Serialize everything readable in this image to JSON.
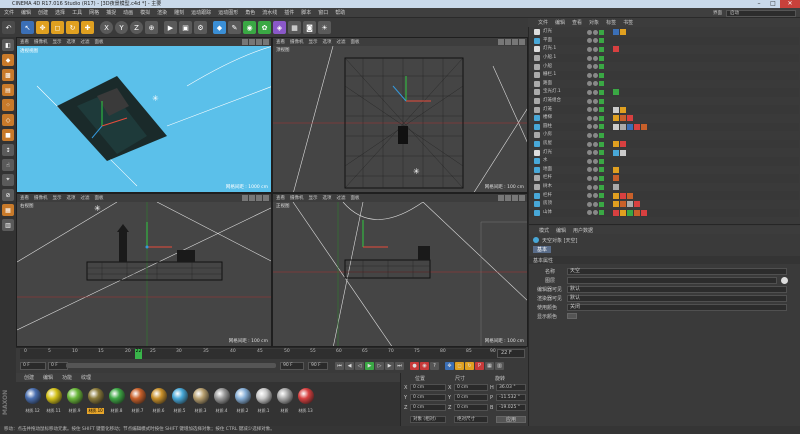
{
  "window": {
    "title": "CINEMA 4D R17.016 Studio (R17) - [3D夜景模型.c4d *] - 主要"
  },
  "menubar": [
    "文件",
    "编辑",
    "创建",
    "选择",
    "工具",
    "网格",
    "捕捉",
    "动画",
    "模拟",
    "渲染",
    "雕刻",
    "运动跟踪",
    "运动图形",
    "角色",
    "流水线",
    "插件",
    "脚本",
    "窗口",
    "帮助"
  ],
  "layout_label": "界面",
  "layout_value": "启动",
  "toolbar": {
    "icons": [
      "undo-icon",
      "live-select-icon",
      "move-icon",
      "scale-icon",
      "rotate-icon",
      "recent-icon",
      "x-axis-icon",
      "y-axis-icon",
      "z-axis-icon",
      "world-coord-icon",
      "render-view-icon",
      "render-picture-icon",
      "render-settings-icon",
      "cube-icon",
      "pen-icon",
      "subdivision-icon",
      "array-icon",
      "deformer-icon",
      "floor-icon",
      "camera-icon",
      "light-icon"
    ],
    "axis_labels": [
      "X",
      "Y",
      "Z"
    ]
  },
  "viewports": {
    "menu_items": [
      "查看",
      "摄像机",
      "显示",
      "选项",
      "过滤",
      "面板"
    ],
    "perspective": {
      "label": "透视视图",
      "scale": "网格间距 : 1000 cm"
    },
    "top": {
      "label": "顶视图",
      "scale": "网格间距 : 100 cm"
    },
    "right": {
      "label": "右视图",
      "scale": "网格间距 : 100 cm"
    },
    "front": {
      "label": "正视图",
      "scale": "网格间距 : 100 cm"
    }
  },
  "timeline": {
    "ticks": [
      "0",
      "5",
      "10",
      "15",
      "20",
      "22",
      "25",
      "30",
      "35",
      "40",
      "45",
      "50",
      "55",
      "60",
      "65",
      "70",
      "75",
      "80",
      "85",
      "90"
    ],
    "current_frame": "22",
    "frame_indicator": "22 F",
    "start": "0 F",
    "start_field": "0 F",
    "end_field": "90 F",
    "end": "90 F"
  },
  "materials": {
    "menu": [
      "创建",
      "编辑",
      "功能",
      "纹理"
    ],
    "items": [
      {
        "name": "材质.12",
        "color": "#4a6fb0"
      },
      {
        "name": "材质.11",
        "color": "#d4c21a"
      },
      {
        "name": "材质.9",
        "color": "#6ab83a"
      },
      {
        "name": "材质.10",
        "color": "#8a7a3a",
        "selected": true
      },
      {
        "name": "材质.8",
        "color": "#3ea845"
      },
      {
        "name": "材质.7",
        "color": "#c8602a"
      },
      {
        "name": "材质.6",
        "color": "#c8902a"
      },
      {
        "name": "材质.5",
        "color": "#48a8d8"
      },
      {
        "name": "材质.3",
        "color": "#b8a070"
      },
      {
        "name": "材质.4",
        "color": "#9a9a9a"
      },
      {
        "name": "材质.2",
        "color": "#88b0d8"
      },
      {
        "name": "材质.1",
        "color": "#c8c8c8"
      },
      {
        "name": "材质",
        "color": "#aaaaaa"
      },
      {
        "name": "材质.13",
        "color": "#d84040"
      }
    ]
  },
  "coords": {
    "headers": [
      "位置",
      "尺寸",
      "旋转"
    ],
    "rows": [
      {
        "axis": "X",
        "pos": "0 cm",
        "size": "0 cm",
        "rot_label": "H",
        "rot": "36.03 °"
      },
      {
        "axis": "Y",
        "pos": "0 cm",
        "size": "0 cm",
        "rot_label": "P",
        "rot": "-11.532 °"
      },
      {
        "axis": "Z",
        "pos": "0 cm",
        "size": "0 cm",
        "rot_label": "B",
        "rot": "-19.025 °"
      }
    ],
    "mode1": "对象 (相对)",
    "mode2": "绝对尺寸",
    "apply": "应用"
  },
  "objects": {
    "menu": [
      "文件",
      "编辑",
      "查看",
      "对象",
      "标签",
      "书签"
    ],
    "items": [
      {
        "name": "灯光",
        "tag": "light"
      },
      {
        "name": "平面",
        "tag": "plane"
      },
      {
        "name": "灯光.1",
        "tag": "light"
      },
      {
        "name": "小船.1",
        "tag": "null"
      },
      {
        "name": "小船",
        "tag": "null"
      },
      {
        "name": "栅栏.1",
        "tag": "null"
      },
      {
        "name": "路面",
        "tag": "null"
      },
      {
        "name": "宝光灯.1",
        "tag": "null"
      },
      {
        "name": "灯笼组合",
        "tag": "null"
      },
      {
        "name": "灯笼",
        "tag": "null"
      },
      {
        "name": "楼梯",
        "tag": "obj"
      },
      {
        "name": "圆柱",
        "tag": "obj"
      },
      {
        "name": "小房",
        "tag": "null"
      },
      {
        "name": "房屋",
        "tag": "obj"
      },
      {
        "name": "灯光",
        "tag": "light"
      },
      {
        "name": "水",
        "tag": "obj"
      },
      {
        "name": "地面",
        "tag": "obj"
      },
      {
        "name": "栏杆",
        "tag": "null"
      },
      {
        "name": "树木",
        "tag": "null"
      },
      {
        "name": "栏杆",
        "tag": "obj"
      },
      {
        "name": "房顶",
        "tag": "obj"
      },
      {
        "name": "山体",
        "tag": "obj"
      }
    ]
  },
  "attributes": {
    "menu": [
      "模式",
      "编辑",
      "用户数据"
    ],
    "object_title": "天空对象 [天空]",
    "tabs": [
      "基本"
    ],
    "section": "基本属性",
    "fields": [
      {
        "label": "名称",
        "value": "天空"
      },
      {
        "label": "图层",
        "value": ""
      },
      {
        "label": "编辑器可见",
        "value": "默认"
      },
      {
        "label": "渲染器可见",
        "value": "默认"
      },
      {
        "label": "使用颜色",
        "value": "关闭"
      },
      {
        "label": "显示颜色",
        "value": ""
      }
    ]
  },
  "status": "移动：点击并拖动鼠标移动元素。按住 SHIFT 键量化移动；节点编辑模式时按住 SHIFT 键增加选择对象；按住 CTRL 键减少选择对象。"
}
